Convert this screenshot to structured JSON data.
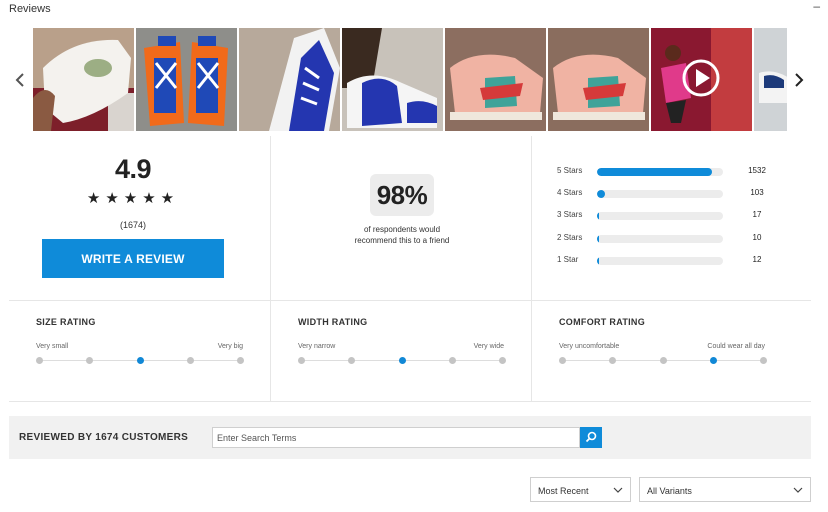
{
  "header": {
    "title": "Reviews",
    "collapse": "–"
  },
  "gallery": {
    "thumbs": [
      {
        "name": "review-photo-1"
      },
      {
        "name": "review-photo-2"
      },
      {
        "name": "review-photo-3"
      },
      {
        "name": "review-photo-4"
      },
      {
        "name": "review-photo-5"
      },
      {
        "name": "review-photo-6"
      },
      {
        "name": "review-video-7"
      },
      {
        "name": "review-photo-8"
      }
    ],
    "arrow_left_icon": "chevron-left-icon",
    "arrow_right_icon": "chevron-right-icon"
  },
  "summary": {
    "average": "4.9",
    "stars": "★★★★★",
    "count": "(1674)",
    "write_review_label": "WRITE A REVIEW",
    "recommend_pct": "98%",
    "recommend_text": "of respondents would recommend this to a friend",
    "distribution": [
      {
        "label": "5 Stars",
        "count": "1532",
        "fraction": 0.915
      },
      {
        "label": "4 Stars",
        "count": "103",
        "fraction": 0.062
      },
      {
        "label": "3 Stars",
        "count": "17",
        "fraction": 0.01
      },
      {
        "label": "2 Stars",
        "count": "10",
        "fraction": 0.006
      },
      {
        "label": "1 Star",
        "count": "12",
        "fraction": 0.007
      }
    ]
  },
  "ratings": [
    {
      "title": "SIZE RATING",
      "min": "Very small",
      "max": "Very big",
      "selected_index": 2,
      "points": 5
    },
    {
      "title": "WIDTH RATING",
      "min": "Very narrow",
      "max": "Very wide",
      "selected_index": 2,
      "points": 5
    },
    {
      "title": "COMFORT RATING",
      "min": "Very uncomfortable",
      "max": "Could wear all day",
      "selected_index": 3,
      "points": 5
    }
  ],
  "reviewed": {
    "label": "REVIEWED BY 1674 CUSTOMERS",
    "search_placeholder": "Enter Search Terms",
    "search_value": ""
  },
  "filters": {
    "sort_selected": "Most Recent",
    "variant_selected": "All Variants"
  },
  "colors": {
    "accent": "#0f8bd9",
    "track": "#ececec"
  }
}
